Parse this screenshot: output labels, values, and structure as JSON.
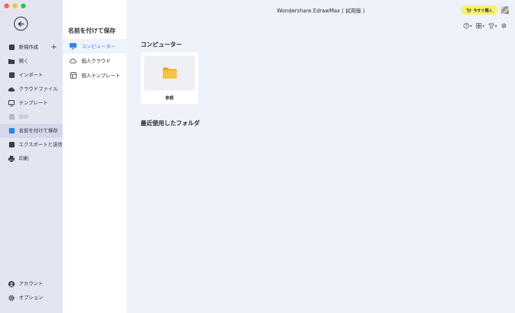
{
  "window": {
    "title": "Wondershare EdrawMax ( 試用版 )",
    "buy_label": "今すぐ購入"
  },
  "sidebar": {
    "items": [
      {
        "label": "新規作成",
        "icon": "plus-square-icon",
        "has_plus": true,
        "plus": "+"
      },
      {
        "label": "開く",
        "icon": "folder-icon"
      },
      {
        "label": "インポート",
        "icon": "import-icon"
      },
      {
        "label": "クラウドファイル",
        "icon": "cloud-icon"
      },
      {
        "label": "テンプレート",
        "icon": "template-icon"
      },
      {
        "label": "保存",
        "icon": "save-icon",
        "disabled": true
      },
      {
        "label": "名前を付けて保存",
        "icon": "save-as-icon",
        "active": true
      },
      {
        "label": "エクスポートと送信",
        "icon": "export-icon"
      },
      {
        "label": "印刷",
        "icon": "print-icon"
      }
    ],
    "bottom_items": [
      {
        "label": "アカウント",
        "icon": "account-icon"
      },
      {
        "label": "オプション",
        "icon": "gear-icon"
      }
    ]
  },
  "save_panel": {
    "title": "名前を付けて保存",
    "items": [
      {
        "label": "コンピューター",
        "icon": "monitor-icon",
        "active": true
      },
      {
        "label": "個人クラウド",
        "icon": "cloud-outline-icon"
      },
      {
        "label": "個人テンプレート",
        "icon": "template-outline-icon"
      }
    ]
  },
  "main": {
    "section_computer": "コンピューター",
    "browse_label": "参照",
    "section_recent": "最近使用したフォルダ"
  },
  "colors": {
    "accent": "#2e86e4",
    "buy_button": "#fcef6b",
    "folder": "#f6c342"
  }
}
